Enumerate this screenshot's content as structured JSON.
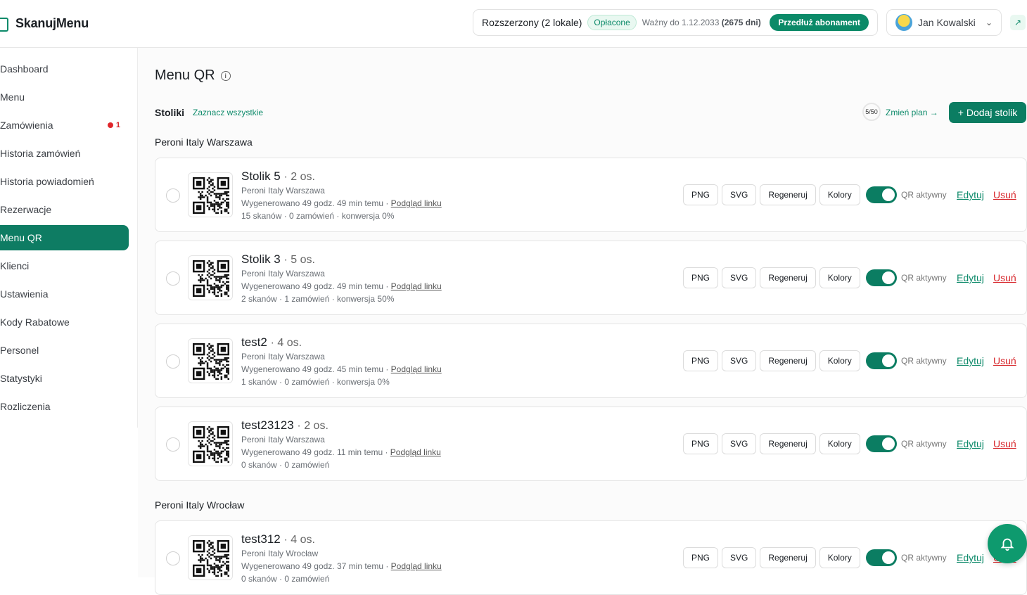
{
  "header": {
    "logo": "SkanujMenu",
    "plan_name": "Rozszerzony (2 lokale)",
    "paid_badge": "Opłacone",
    "valid_prefix": "Ważny do 1.12.2033",
    "valid_days": "(2675 dni)",
    "extend_label": "Przedłuż abonament",
    "user_name": "Jan Kowalski"
  },
  "sidebar": {
    "items": [
      {
        "label": "Dashboard"
      },
      {
        "label": "Menu"
      },
      {
        "label": "Zamówienia",
        "badge": "1"
      },
      {
        "label": "Historia zamówień"
      },
      {
        "label": "Historia powiadomień"
      },
      {
        "label": "Rezerwacje"
      },
      {
        "label": "Menu QR",
        "active": true
      },
      {
        "label": "Klienci"
      },
      {
        "label": "Ustawienia"
      },
      {
        "label": "Kody Rabatowe"
      },
      {
        "label": "Personel"
      },
      {
        "label": "Statystyki"
      },
      {
        "label": "Rozliczenia"
      }
    ]
  },
  "main": {
    "title": "Menu QR",
    "tables_label": "Stoliki",
    "select_all": "Zaznacz wszystkie",
    "quota": "5/50",
    "change_plan": "Zmień plan →",
    "add_table": "+ Dodaj stolik",
    "buttons": {
      "png": "PNG",
      "svg": "SVG",
      "regen": "Regeneruj",
      "colors": "Kolory",
      "qr_active": "QR aktywny",
      "edit": "Edytuj",
      "delete": "Usuń"
    },
    "groups": [
      {
        "name": "Peroni Italy Warszawa",
        "tables": [
          {
            "name": "Stolik 5",
            "capacity": "· 2 os.",
            "location": "Peroni Italy Warszawa",
            "generated": "Wygenerowano 49 godz. 49 min temu · ",
            "preview": "Podgląd linku",
            "stats": "15 skanów · 0 zamówień · konwersja 0%",
            "active": true
          },
          {
            "name": "Stolik 3",
            "capacity": "· 5 os.",
            "location": "Peroni Italy Warszawa",
            "generated": "Wygenerowano 49 godz. 49 min temu · ",
            "preview": "Podgląd linku",
            "stats": "2 skanów · 1 zamówień · konwersja 50%",
            "active": true
          },
          {
            "name": "test2",
            "capacity": "· 4 os.",
            "location": "Peroni Italy Warszawa",
            "generated": "Wygenerowano 49 godz. 45 min temu · ",
            "preview": "Podgląd linku",
            "stats": "1 skanów · 0 zamówień · konwersja 0%",
            "active": true
          },
          {
            "name": "test23123",
            "capacity": "· 2 os.",
            "location": "Peroni Italy Warszawa",
            "generated": "Wygenerowano 49 godz. 11 min temu · ",
            "preview": "Podgląd linku",
            "stats": "0 skanów · 0 zamówień",
            "active": true
          }
        ]
      },
      {
        "name": "Peroni Italy Wrocław",
        "tables": [
          {
            "name": "test312",
            "capacity": "· 4 os.",
            "location": "Peroni Italy Wrocław",
            "generated": "Wygenerowano 49 godz. 37 min temu · ",
            "preview": "Podgląd linku",
            "stats": "0 skanów · 0 zamówień",
            "active": true
          }
        ]
      }
    ]
  },
  "colors": {
    "accent": "#0b7d62",
    "danger": "#d7262b"
  }
}
